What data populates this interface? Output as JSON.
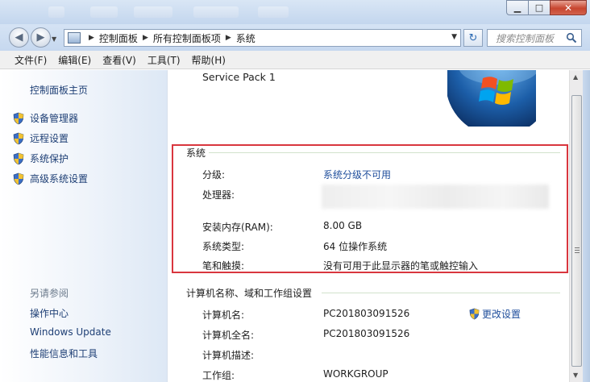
{
  "window": {
    "min_glyph": "▁",
    "max_glyph": "□",
    "close_glyph": "✕"
  },
  "nav": {
    "back_glyph": "◀",
    "forward_glyph": "▶",
    "recent_glyph": "▼",
    "breadcrumbs": [
      "控制面板",
      "所有控制面板项",
      "系统"
    ],
    "crumb_separator": "▶",
    "address_drop_glyph": "▼",
    "refresh_glyph": "↻",
    "search_placeholder": "搜索控制面板"
  },
  "menu": [
    "文件(F)",
    "编辑(E)",
    "查看(V)",
    "工具(T)",
    "帮助(H)"
  ],
  "sidebar": {
    "home": "控制面板主页",
    "items": [
      "设备管理器",
      "远程设置",
      "系统保护",
      "高级系统设置"
    ],
    "see_also_title": "另请参阅",
    "see_also": [
      "操作中心",
      "Windows Update",
      "性能信息和工具"
    ]
  },
  "main": {
    "service_pack": "Service Pack 1",
    "system_section": {
      "title": "系统",
      "rows": [
        {
          "label": "分级:",
          "value": "系统分级不可用",
          "is_link": true
        },
        {
          "label": "处理器:",
          "value": ""
        },
        {
          "label": "安装内存(RAM):",
          "value": "8.00 GB"
        },
        {
          "label": "系统类型:",
          "value": "64 位操作系统"
        },
        {
          "label": "笔和触摸:",
          "value": "没有可用于此显示器的笔或触控输入"
        }
      ]
    },
    "computer_section": {
      "title": "计算机名称、域和工作组设置",
      "change_settings": "更改设置",
      "rows": [
        {
          "label": "计算机名:",
          "value": "PC201803091526"
        },
        {
          "label": "计算机全名:",
          "value": "PC201803091526"
        },
        {
          "label": "计算机描述:",
          "value": ""
        },
        {
          "label": "工作组:",
          "value": "WORKGROUP"
        }
      ]
    }
  },
  "scrollbar": {
    "up_glyph": "▲",
    "down_glyph": "▼"
  },
  "colors": {
    "link": "#1f4e9c",
    "highlight_border": "#d9363e",
    "sidebar_link": "#1e3f75"
  }
}
